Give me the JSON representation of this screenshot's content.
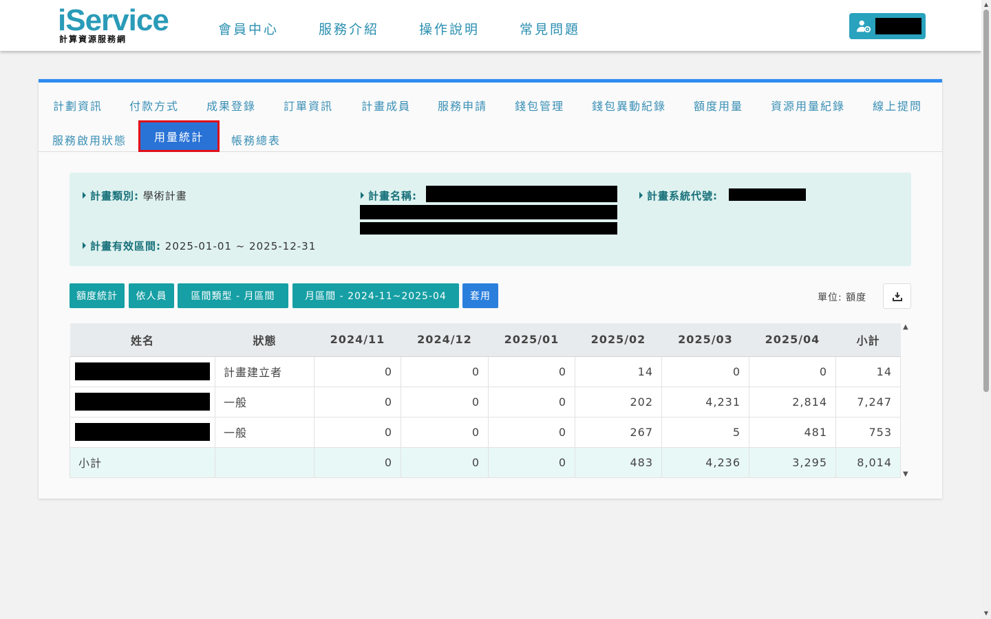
{
  "header": {
    "logo_main": "iService",
    "logo_sub": "計算資源服務網",
    "nav": [
      "會員中心",
      "服務介紹",
      "操作說明",
      "常見問題"
    ],
    "user_icon": "user-cog-icon"
  },
  "tabs": {
    "row1": [
      "計劃資訊",
      "付款方式",
      "成果登錄",
      "訂單資訊",
      "計畫成員",
      "服務申請",
      "錢包管理",
      "錢包異動紀錄",
      "額度用量",
      "資源用量紀錄",
      "線上提問"
    ],
    "row2": [
      "服務啟用狀態",
      "用量統計",
      "帳務總表"
    ],
    "active": "用量統計"
  },
  "project": {
    "type_label": "計畫類別:",
    "type_value": "學術計畫",
    "name_label": "計畫名稱:",
    "system_code_label": "計畫系統代號:",
    "period_label": "計畫有效區間:",
    "period_value": "2025-01-01 ~ 2025-12-31"
  },
  "filters": {
    "stat_type": "額度統計",
    "group_by": "依人員",
    "interval_type": "區間類型 - 月區間",
    "month_range": "月區間 - 2024-11~2025-04",
    "apply": "套用",
    "unit": "單位: 額度",
    "download_icon": "download-icon"
  },
  "table": {
    "headers": [
      "姓名",
      "狀態",
      "2024/11",
      "2024/12",
      "2025/01",
      "2025/02",
      "2025/03",
      "2025/04",
      "小計"
    ],
    "rows": [
      {
        "status": "計畫建立者",
        "values": [
          "0",
          "0",
          "0",
          "14",
          "0",
          "0",
          "14"
        ]
      },
      {
        "status": "一般",
        "values": [
          "0",
          "0",
          "0",
          "202",
          "4,231",
          "2,814",
          "7,247"
        ]
      },
      {
        "status": "一般",
        "values": [
          "0",
          "0",
          "0",
          "267",
          "5",
          "481",
          "753"
        ]
      }
    ],
    "subtotal": {
      "label": "小計",
      "values": [
        "0",
        "0",
        "0",
        "483",
        "4,236",
        "3,295",
        "8,014"
      ]
    }
  },
  "colors": {
    "brand": "#2a9bb8",
    "accent_bar": "#2f8cf0",
    "active_tab": "#2a73d6",
    "active_outline": "#e0101a",
    "filter_button": "#169fa4",
    "info_bg": "#dff2ef"
  }
}
